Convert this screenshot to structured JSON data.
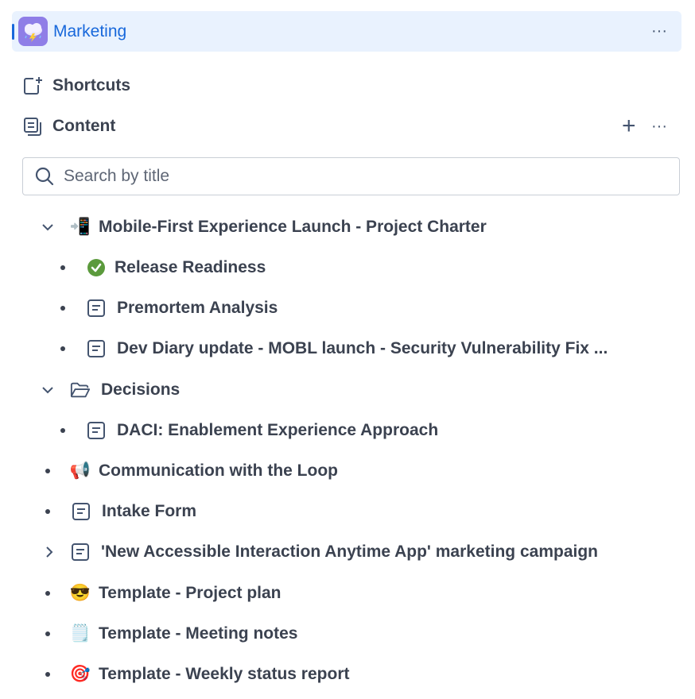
{
  "space": {
    "name": "Marketing",
    "avatar_icon": "storm-cloud-icon",
    "accent_color": "#1868db",
    "more_label": "···"
  },
  "nav": {
    "shortcuts_label": "Shortcuts",
    "content_label": "Content",
    "add_label": "+",
    "more_label": "···"
  },
  "search": {
    "placeholder": "Search by title",
    "value": ""
  },
  "tree": {
    "items": [
      {
        "title": "Mobile-First Experience Launch - Project Charter",
        "icon": "📲",
        "expander": "chevron-down-icon"
      },
      {
        "title": "Release Readiness",
        "icon": "check-circle-icon"
      },
      {
        "title": "Premortem Analysis",
        "icon": "page-icon"
      },
      {
        "title": "Dev Diary update - MOBL launch - Security Vulnerability Fix ...",
        "icon": "page-icon"
      },
      {
        "title": "Decisions",
        "icon": "folder-icon",
        "expander": "chevron-down-icon"
      },
      {
        "title": "DACI: Enablement Experience Approach",
        "icon": "page-icon"
      },
      {
        "title": "Communication with the Loop",
        "icon": "📢"
      },
      {
        "title": "Intake Form",
        "icon": "page-icon"
      },
      {
        "title": "'New Accessible Interaction Anytime App' marketing campaign",
        "icon": "page-icon",
        "expander": "chevron-right-icon"
      },
      {
        "title": "Template - Project plan",
        "icon": "😎"
      },
      {
        "title": "Template - Meeting notes",
        "icon": "🗒️"
      },
      {
        "title": "Template - Weekly status report",
        "icon": "🎯"
      }
    ]
  }
}
